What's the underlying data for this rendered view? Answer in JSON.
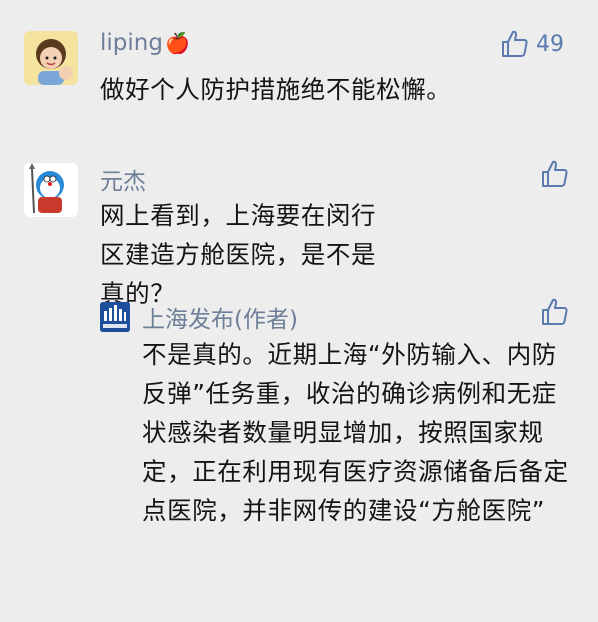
{
  "comments": [
    {
      "user": "liping",
      "name_emoji": "🍎",
      "text": "做好个人防护措施绝不能松懈。",
      "likes": "49"
    },
    {
      "user": "元杰",
      "text": "网上看到，上海要在闵行区建造方舱医院，是不是真的？",
      "likes": "",
      "reply": {
        "user": "上海发布(作者)",
        "avatar_text": "上海发布",
        "text": "不是真的。近期上海“外防输入、内防反弹”任务重，收治的确诊病例和无症状感染者数量明显增加，按照国家规定，正在利用现有医疗资源储备后备定点医院，并非网传的建设“方舱医院”",
        "likes": ""
      }
    }
  ],
  "colors": {
    "background": "#ededed",
    "name": "#6e7f98",
    "like": "#5a7ab0"
  }
}
